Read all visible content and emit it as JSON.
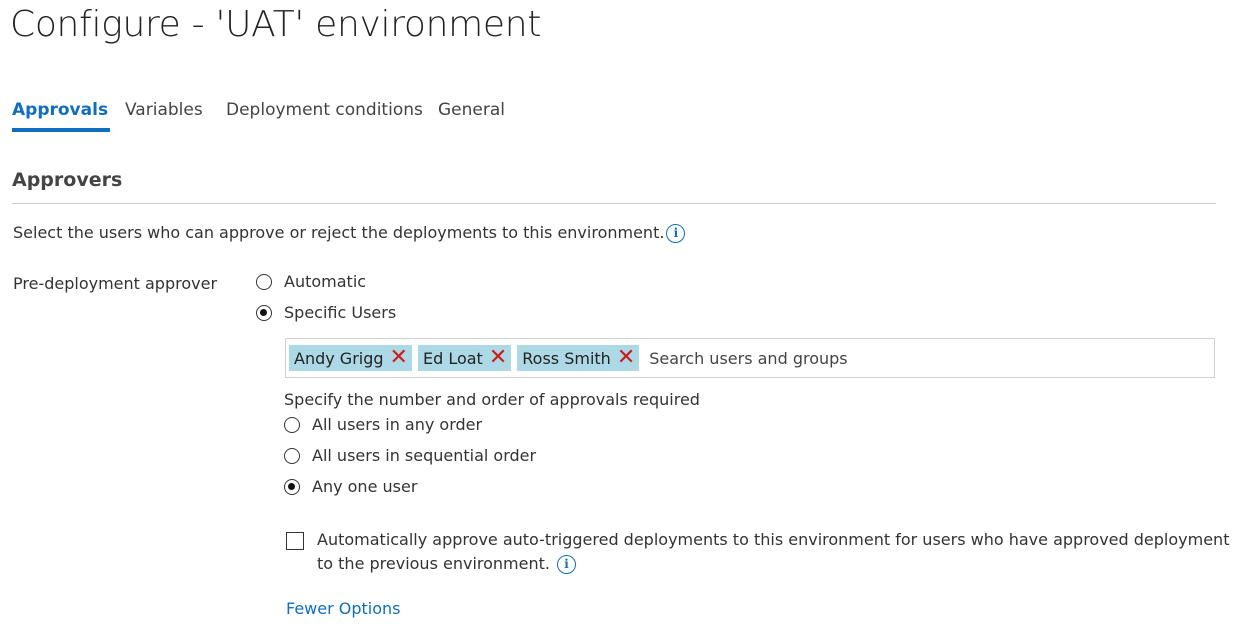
{
  "page": {
    "title": "Configure - 'UAT' environment"
  },
  "tabs": [
    {
      "label": "Approvals",
      "active": true
    },
    {
      "label": "Variables",
      "active": false
    },
    {
      "label": "Deployment conditions",
      "active": false
    },
    {
      "label": "General",
      "active": false
    }
  ],
  "approvers": {
    "section_title": "Approvers",
    "description": "Select the users who can approve or reject the deployments to this environment.",
    "info_icon": "i",
    "pre_deployment_label": "Pre-deployment approver",
    "options": [
      {
        "label": "Automatic",
        "checked": false
      },
      {
        "label": "Specific Users",
        "checked": true
      }
    ],
    "selected_users": [
      "Andy Grigg",
      "Ed Loat",
      "Ross Smith"
    ],
    "remove_glyph": "✕",
    "search_placeholder": "Search users and groups",
    "order_label": "Specify the number and order of approvals required",
    "order_options": [
      {
        "label": "All users in any order",
        "checked": false
      },
      {
        "label": "All users in sequential order",
        "checked": false
      },
      {
        "label": "Any one user",
        "checked": true
      }
    ],
    "auto_approve_label": "Automatically approve auto-triggered deployments to this environment for users who have approved deployment to the previous environment.",
    "auto_approve_checked": false,
    "fewer_options_link": "Fewer Options"
  },
  "colors": {
    "accent": "#106ebe",
    "chip_bg": "#add8e6",
    "remove_x": "#d11b1b"
  }
}
